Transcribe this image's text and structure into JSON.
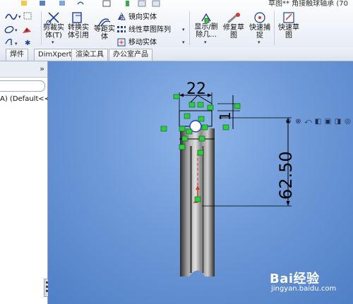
{
  "ribbon": {
    "title_fragment": "草图** 角接触球轴承 (70",
    "cut_extrude_label_1": "剪裁实",
    "cut_extrude_label_2": "体(T)",
    "convert_entities_label_1": "转换实",
    "convert_entities_label_2": "体引用",
    "offset_entities_label_1": "等距实",
    "offset_entities_label_2": "体",
    "mirror_entities_label": "镜向实体",
    "linear_pattern_label": "线性草图阵列",
    "move_entities_label": "移动实体",
    "show_delete_relations_label_1": "显示/删",
    "show_delete_relations_label_2": "除几...",
    "repair_sketch_label_1": "修复草",
    "repair_sketch_label_2": "图",
    "quick_snaps_label_1": "快速捕",
    "quick_snaps_label_2": "捉",
    "rapid_sketch_label_1": "快速草",
    "rapid_sketch_label_2": "图"
  },
  "tabs": [
    "焊件",
    "DimXpert",
    "渲染工具",
    "办公室产品"
  ],
  "left_panel": {
    "tree_item": "A)  (Default<<"
  },
  "dimensions": {
    "width": "22",
    "small": "1",
    "height": "62.50"
  },
  "watermark": {
    "logo": "Bai经验",
    "url": "jingyan.baidu.com"
  },
  "colors": {
    "viewport_bg": "#6f9ad8",
    "relation_green": "#2ecc40",
    "sketch_black": "#000000"
  }
}
